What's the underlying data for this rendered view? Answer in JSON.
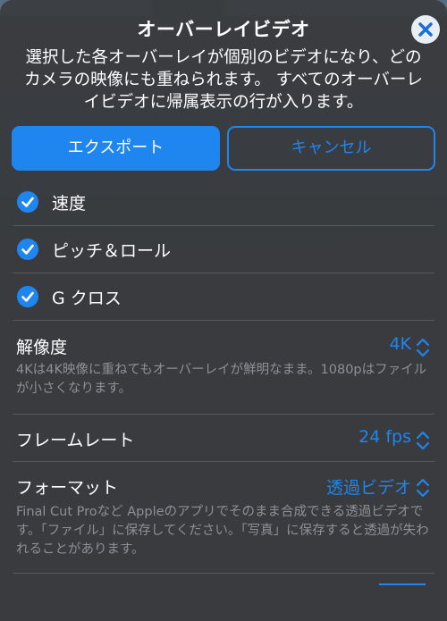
{
  "dialog": {
    "title": "オーバーレイビデオ",
    "description": "選択した各オーバーレイが個別のビデオになり、どのカメラの映像にも重ねられます。 すべてのオーバーレイビデオに帰属表示の行が入ります。",
    "close_icon": "xmark-icon"
  },
  "actions": {
    "export_label": "エクスポート",
    "cancel_label": "キャンセル"
  },
  "overlays": [
    {
      "label": "速度",
      "checked": true
    },
    {
      "label": "ピッチ＆ロール",
      "checked": true
    },
    {
      "label": "G クロス",
      "checked": true
    }
  ],
  "settings": {
    "resolution": {
      "label": "解像度",
      "value": "4K",
      "note": "4Kは4K映像に重ねてもオーバーレイが鮮明なまま。1080pはファイルが小さくなります。"
    },
    "frame_rate": {
      "label": "フレームレート",
      "value": "24 fps"
    },
    "format": {
      "label": "フォーマット",
      "value": "透過ビデオ",
      "note": "Final Cut Proなど Appleのアプリでそのまま合成できる透過ビデオです。「ファイル」に保存してください。「写真」に保存すると透過が失われることがあります。"
    }
  },
  "colors": {
    "accent": "#1f86ef",
    "sheet_background": "#3a3c40",
    "secondary_text": "#8c9097"
  }
}
